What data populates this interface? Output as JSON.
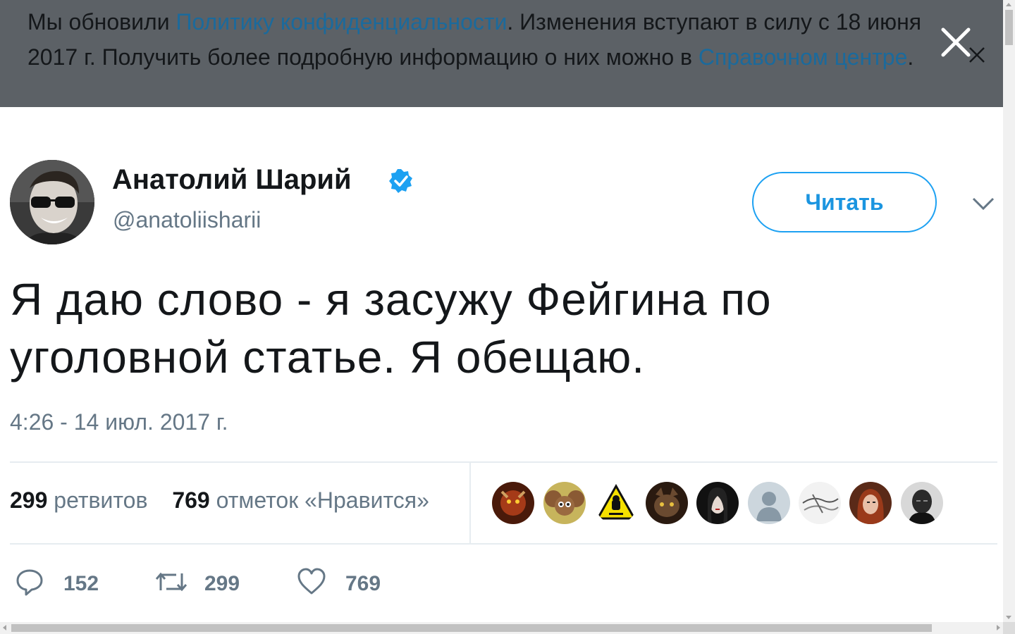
{
  "banner": {
    "text_before": "Мы обновили ",
    "privacy_link": "Политику конфиденциальности",
    "text_middle": ". Изменения вступают в силу с 18 июня 2017 г. Получить более подробную информацию о них можно в ",
    "help_link": "Справочном центре",
    "text_after": "."
  },
  "tweet": {
    "author_name": "Анатолий Шарий",
    "handle": "@anatoliisharii",
    "follow_label": "Читать",
    "text": "Я даю слово - я засужу Фейгина по уголовной статье. Я обещаю.",
    "timestamp": "4:26 - 14 июл. 2017 г."
  },
  "stats": {
    "retweets_count": "299",
    "retweets_label": "ретвитов",
    "likes_count": "769",
    "likes_label": "отметок «Нравится»"
  },
  "actions": {
    "reply_count": "152",
    "retweet_count": "299",
    "like_count": "769"
  },
  "colors": {
    "banner_bg": "#5c6166",
    "link": "#1b6a9c",
    "accent": "#1da1f2",
    "secondary_text": "#657786"
  },
  "likers": [
    {
      "icon": "warrior-avatar",
      "color": "#8a2a10"
    },
    {
      "icon": "cheburashka-avatar",
      "color": "#b8a24a"
    },
    {
      "icon": "android-warning-avatar",
      "color": "#f5e000"
    },
    {
      "icon": "cat-avatar",
      "color": "#5a3a24"
    },
    {
      "icon": "woman-dark-avatar",
      "color": "#1e1e1e"
    },
    {
      "icon": "default-person-avatar",
      "color": "#ccd6dd"
    },
    {
      "icon": "sketch-avatar",
      "color": "#e8e8e8"
    },
    {
      "icon": "woman-red-hair-avatar",
      "color": "#8b3a1e"
    },
    {
      "icon": "bw-man-avatar",
      "color": "#3a3a3a"
    }
  ]
}
